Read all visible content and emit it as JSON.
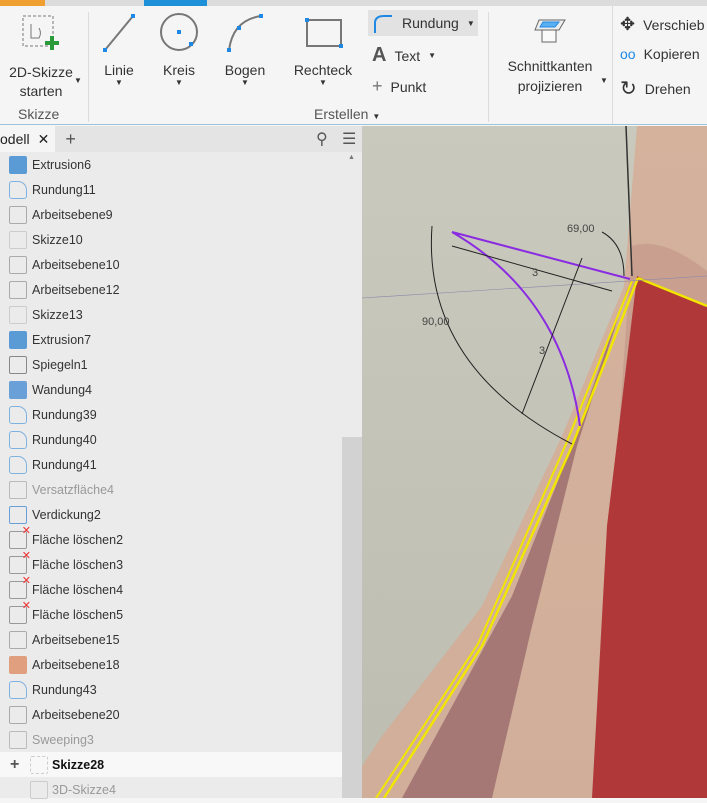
{
  "ribbon": {
    "sketch_start": {
      "line1": "2D-Skizze",
      "line2": "starten"
    },
    "group_skizze": "Skizze",
    "linie": "Linie",
    "kreis": "Kreis",
    "bogen": "Bogen",
    "rechteck": "Rechteck",
    "rundung": "Rundung",
    "text": "Text",
    "punkt": "Punkt",
    "group_erstellen": "Erstellen",
    "schnitt": {
      "line1": "Schnittkanten",
      "line2": "projizieren"
    },
    "verschieben": "Verschieb",
    "kopieren": "Kopieren",
    "drehen": "Drehen"
  },
  "panel": {
    "tab": "odell"
  },
  "tree": [
    {
      "label": "Extrusion6",
      "icon": "extrusion-icon"
    },
    {
      "label": "Rundung11",
      "icon": "fillet-icon"
    },
    {
      "label": "Arbeitsebene9",
      "icon": "workplane-icon"
    },
    {
      "label": "Skizze10",
      "icon": "sketch-icon"
    },
    {
      "label": "Arbeitsebene10",
      "icon": "workplane-icon"
    },
    {
      "label": "Arbeitsebene12",
      "icon": "workplane-icon"
    },
    {
      "label": "Skizze13",
      "icon": "sketch-icon"
    },
    {
      "label": "Extrusion7",
      "icon": "extrusion-icon"
    },
    {
      "label": "Spiegeln1",
      "icon": "mirror-icon"
    },
    {
      "label": "Wandung4",
      "icon": "shell-icon"
    },
    {
      "label": "Rundung39",
      "icon": "fillet-icon"
    },
    {
      "label": "Rundung40",
      "icon": "fillet-icon"
    },
    {
      "label": "Rundung41",
      "icon": "fillet-icon"
    },
    {
      "label": "Versatzfläche4",
      "icon": "offset-surface-icon"
    },
    {
      "label": "Verdickung2",
      "icon": "thicken-icon"
    },
    {
      "label": "Fläche löschen2",
      "icon": "delete-face-icon"
    },
    {
      "label": "Fläche löschen3",
      "icon": "delete-face-icon"
    },
    {
      "label": "Fläche löschen4",
      "icon": "delete-face-icon"
    },
    {
      "label": "Fläche löschen5",
      "icon": "delete-face-icon"
    },
    {
      "label": "Arbeitsebene15",
      "icon": "workplane-icon"
    },
    {
      "label": "Arbeitsebene18",
      "icon": "workplane-icon"
    },
    {
      "label": "Rundung43",
      "icon": "fillet-icon"
    },
    {
      "label": "Arbeitsebene20",
      "icon": "workplane-icon"
    },
    {
      "label": "Sweeping3",
      "icon": "sweep-icon"
    },
    {
      "label": "Skizze28",
      "icon": "sketch-icon"
    },
    {
      "label": "3D-Skizze4",
      "icon": "sketch3d-icon"
    }
  ],
  "viewport": {
    "dim_angle1": "69,00",
    "dim_angle2": "90,00",
    "dim_len1": "3",
    "dim_len2": "3"
  },
  "colors": {
    "accent": "#1e90d8",
    "sketch": "#8a2be2",
    "edge": "#f2e600",
    "body": "#b03838"
  }
}
